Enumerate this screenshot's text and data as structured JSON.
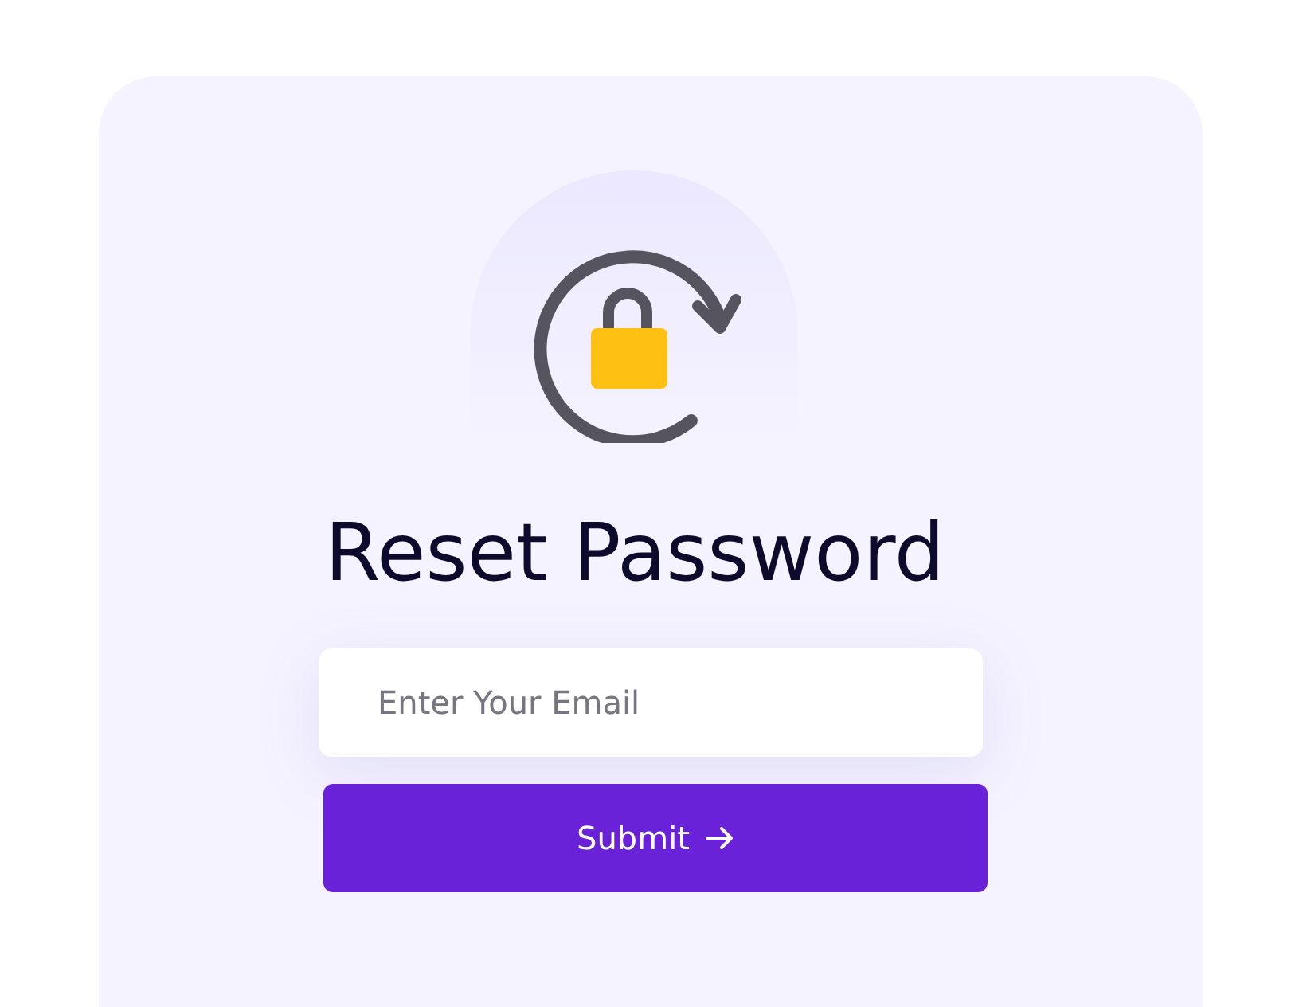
{
  "title": "Reset Password",
  "email": {
    "placeholder": "Enter Your Email"
  },
  "submit": {
    "label": "Submit"
  }
}
